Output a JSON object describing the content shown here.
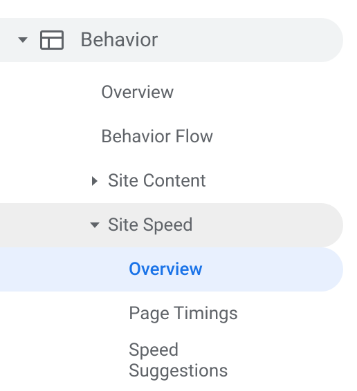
{
  "nav": {
    "behavior": {
      "label": "Behavior"
    },
    "items": {
      "overview": "Overview",
      "behavior_flow": "Behavior Flow",
      "site_content": "Site Content",
      "site_speed": "Site Speed",
      "speed_overview": "Overview",
      "page_timings": "Page Timings",
      "speed_suggestions": "Speed Suggestions"
    }
  }
}
